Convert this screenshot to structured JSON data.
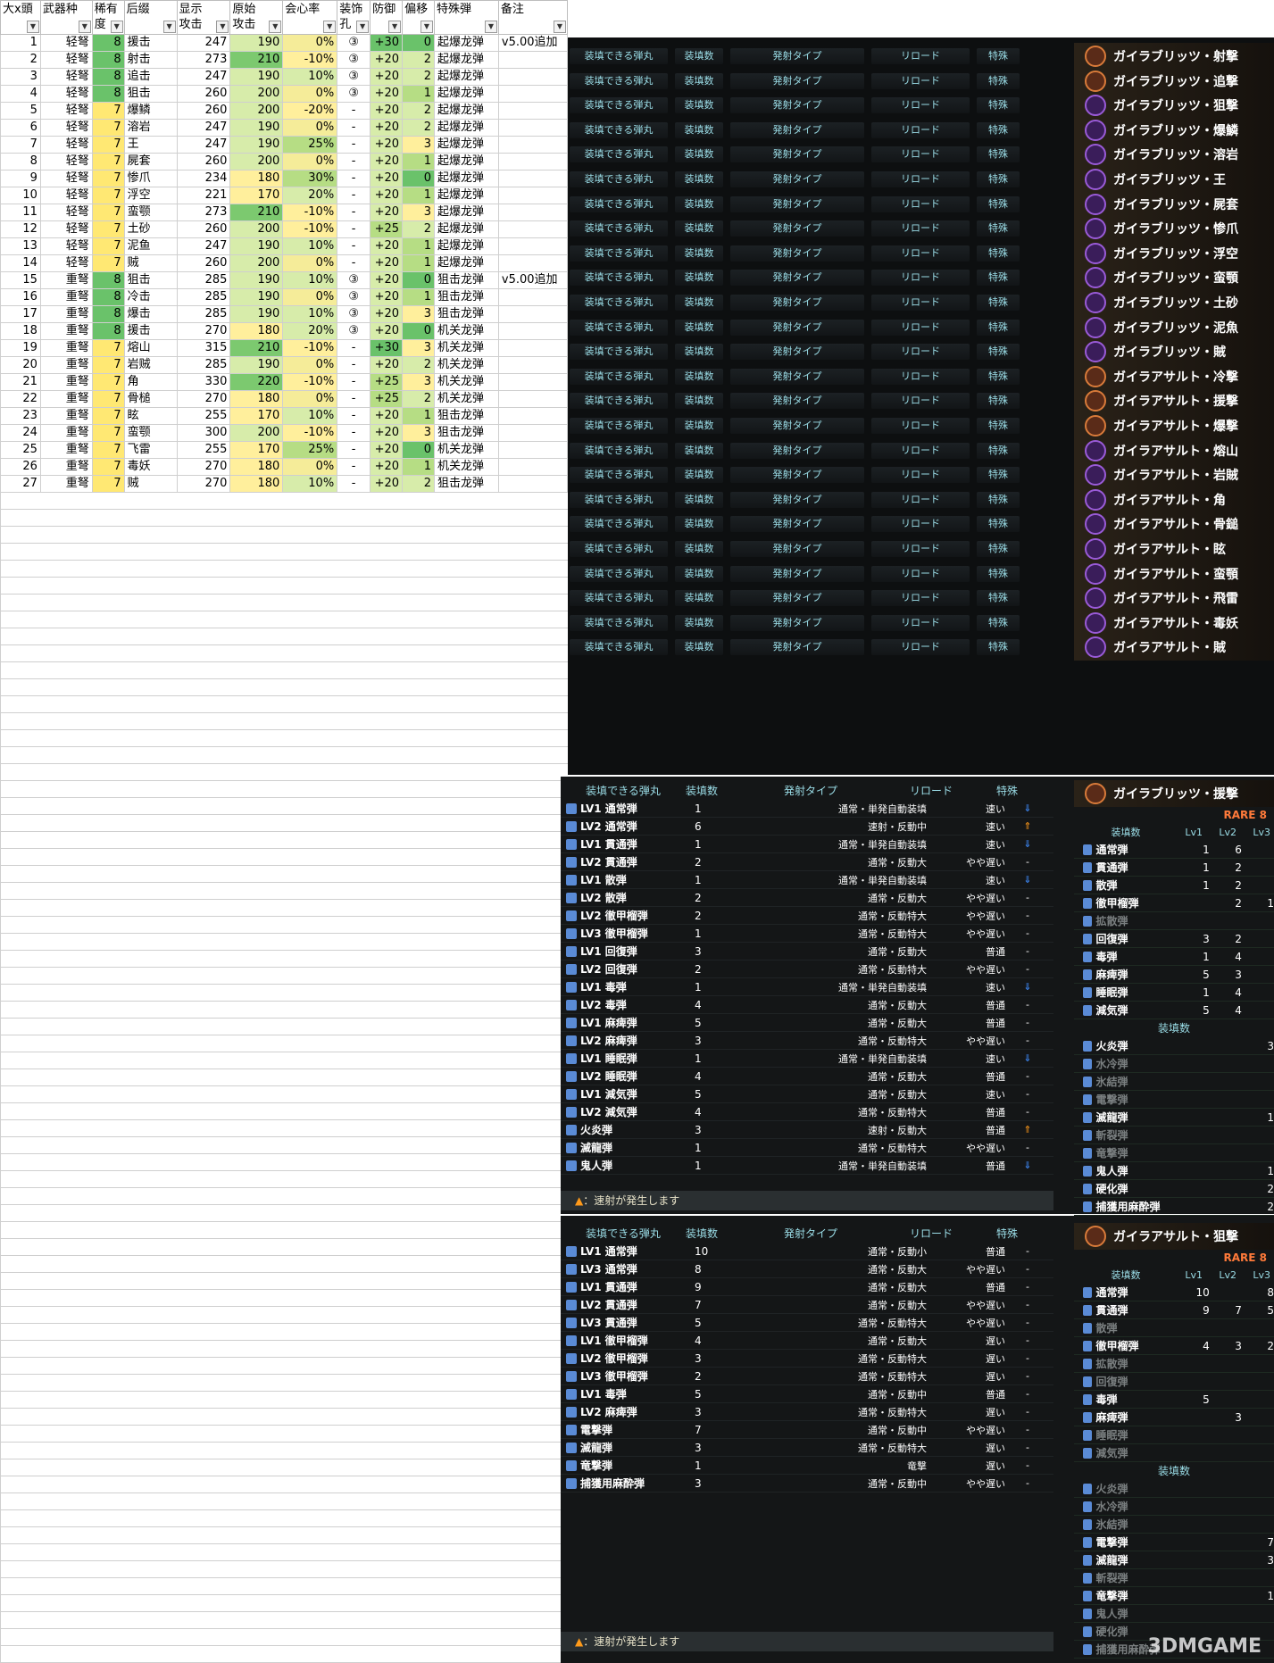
{
  "headers": [
    {
      "t1": "大x頭",
      "t2": ""
    },
    {
      "t1": "武器种",
      "t2": ""
    },
    {
      "t1": "稀有",
      "t2": "度"
    },
    {
      "t1": "后缀",
      "t2": ""
    },
    {
      "t1": "显示",
      "t2": "攻击"
    },
    {
      "t1": "原始",
      "t2": "攻击"
    },
    {
      "t1": "会心率",
      "t2": ""
    },
    {
      "t1": "装饰",
      "t2": "孔"
    },
    {
      "t1": "防御",
      "t2": ""
    },
    {
      "t1": "偏移",
      "t2": ""
    },
    {
      "t1": "特殊弾",
      "t2": ""
    },
    {
      "t1": "备注",
      "t2": ""
    }
  ],
  "rows": [
    [
      "1",
      "轻弩",
      "8",
      "援击",
      "247",
      "190",
      "0%",
      "③",
      "+30",
      "0",
      "起爆龙弹",
      "v5.00追加"
    ],
    [
      "2",
      "轻弩",
      "8",
      "射击",
      "273",
      "210",
      "-10%",
      "③",
      "+20",
      "2",
      "起爆龙弹",
      ""
    ],
    [
      "3",
      "轻弩",
      "8",
      "追击",
      "247",
      "190",
      "10%",
      "③",
      "+20",
      "2",
      "起爆龙弹",
      ""
    ],
    [
      "4",
      "轻弩",
      "8",
      "狙击",
      "260",
      "200",
      "0%",
      "③",
      "+20",
      "1",
      "起爆龙弹",
      ""
    ],
    [
      "5",
      "轻弩",
      "7",
      "爆鳞",
      "260",
      "200",
      "-20%",
      "-",
      "+20",
      "2",
      "起爆龙弹",
      ""
    ],
    [
      "6",
      "轻弩",
      "7",
      "溶岩",
      "247",
      "190",
      "0%",
      "-",
      "+20",
      "2",
      "起爆龙弹",
      ""
    ],
    [
      "7",
      "轻弩",
      "7",
      "王",
      "247",
      "190",
      "25%",
      "-",
      "+20",
      "3",
      "起爆龙弹",
      ""
    ],
    [
      "8",
      "轻弩",
      "7",
      "屍套",
      "260",
      "200",
      "0%",
      "-",
      "+20",
      "1",
      "起爆龙弹",
      ""
    ],
    [
      "9",
      "轻弩",
      "7",
      "惨爪",
      "234",
      "180",
      "30%",
      "-",
      "+20",
      "0",
      "起爆龙弹",
      ""
    ],
    [
      "10",
      "轻弩",
      "7",
      "浮空",
      "221",
      "170",
      "20%",
      "-",
      "+20",
      "1",
      "起爆龙弹",
      ""
    ],
    [
      "11",
      "轻弩",
      "7",
      "蛮颚",
      "273",
      "210",
      "-10%",
      "-",
      "+20",
      "3",
      "起爆龙弹",
      ""
    ],
    [
      "12",
      "轻弩",
      "7",
      "土砂",
      "260",
      "200",
      "-10%",
      "-",
      "+25",
      "2",
      "起爆龙弹",
      ""
    ],
    [
      "13",
      "轻弩",
      "7",
      "泥鱼",
      "247",
      "190",
      "10%",
      "-",
      "+20",
      "1",
      "起爆龙弹",
      ""
    ],
    [
      "14",
      "轻弩",
      "7",
      "贼",
      "260",
      "200",
      "0%",
      "-",
      "+20",
      "1",
      "起爆龙弹",
      ""
    ],
    [
      "15",
      "重弩",
      "8",
      "狙击",
      "285",
      "190",
      "10%",
      "③",
      "+20",
      "0",
      "狙击龙弹",
      "v5.00追加"
    ],
    [
      "16",
      "重弩",
      "8",
      "冷击",
      "285",
      "190",
      "0%",
      "③",
      "+20",
      "1",
      "狙击龙弹",
      ""
    ],
    [
      "17",
      "重弩",
      "8",
      "爆击",
      "285",
      "190",
      "10%",
      "③",
      "+20",
      "3",
      "狙击龙弹",
      ""
    ],
    [
      "18",
      "重弩",
      "8",
      "援击",
      "270",
      "180",
      "20%",
      "③",
      "+20",
      "0",
      "机关龙弹",
      ""
    ],
    [
      "19",
      "重弩",
      "7",
      "熔山",
      "315",
      "210",
      "-10%",
      "-",
      "+30",
      "3",
      "机关龙弹",
      ""
    ],
    [
      "20",
      "重弩",
      "7",
      "岩贼",
      "285",
      "190",
      "0%",
      "-",
      "+20",
      "2",
      "机关龙弹",
      ""
    ],
    [
      "21",
      "重弩",
      "7",
      "角",
      "330",
      "220",
      "-10%",
      "-",
      "+25",
      "3",
      "机关龙弹",
      ""
    ],
    [
      "22",
      "重弩",
      "7",
      "骨槌",
      "270",
      "180",
      "0%",
      "-",
      "+25",
      "2",
      "机关龙弹",
      ""
    ],
    [
      "23",
      "重弩",
      "7",
      "眩",
      "255",
      "170",
      "10%",
      "-",
      "+20",
      "1",
      "狙击龙弹",
      ""
    ],
    [
      "24",
      "重弩",
      "7",
      "蛮颚",
      "300",
      "200",
      "-10%",
      "-",
      "+20",
      "3",
      "狙击龙弹",
      ""
    ],
    [
      "25",
      "重弩",
      "7",
      "飞雷",
      "255",
      "170",
      "25%",
      "-",
      "+20",
      "0",
      "机关龙弹",
      ""
    ],
    [
      "26",
      "重弩",
      "7",
      "毒妖",
      "270",
      "180",
      "0%",
      "-",
      "+20",
      "1",
      "机关龙弹",
      ""
    ],
    [
      "27",
      "重弩",
      "7",
      "贼",
      "270",
      "180",
      "10%",
      "-",
      "+20",
      "2",
      "狙击龙弹",
      ""
    ]
  ],
  "list_labels": {
    "a": "装填できる弾丸",
    "b": "装填数",
    "c": "発射タイプ",
    "d": "リロード",
    "e": "特殊"
  },
  "weapons": [
    "ガイラブリッツ・射撃",
    "ガイラブリッツ・追撃",
    "ガイラブリッツ・狙撃",
    "ガイラブリッツ・爆鱗",
    "ガイラブリッツ・溶岩",
    "ガイラブリッツ・王",
    "ガイラブリッツ・屍套",
    "ガイラブリッツ・惨爪",
    "ガイラブリッツ・浮空",
    "ガイラブリッツ・蛮顎",
    "ガイラブリッツ・土砂",
    "ガイラブリッツ・泥魚",
    "ガイラブリッツ・賊",
    "ガイラアサルト・冷撃",
    "ガイラアサルト・援撃",
    "ガイラアサルト・爆撃",
    "ガイラアサルト・熔山",
    "ガイラアサルト・岩賊",
    "ガイラアサルト・角",
    "ガイラアサルト・骨鎚",
    "ガイラアサルト・眩",
    "ガイラアサルト・蛮顎",
    "ガイラアサルト・飛雷",
    "ガイラアサルト・毒妖",
    "ガイラアサルト・賊"
  ],
  "panel1": {
    "title": "ガイラブリッツ・援撃",
    "rare": "RARE 8",
    "ammo": [
      [
        "LV1 通常弾",
        "1",
        "通常・単発自動装填",
        "速い",
        "dn"
      ],
      [
        "LV2 通常弾",
        "6",
        "速射・反動中",
        "速い",
        "up"
      ],
      [
        "LV1 貫通弾",
        "1",
        "通常・単発自動装填",
        "速い",
        "dn"
      ],
      [
        "LV2 貫通弾",
        "2",
        "通常・反動大",
        "やや遅い",
        "-"
      ],
      [
        "LV1 散弾",
        "1",
        "通常・単発自動装填",
        "速い",
        "dn"
      ],
      [
        "LV2 散弾",
        "2",
        "通常・反動大",
        "やや遅い",
        "-"
      ],
      [
        "LV2 徹甲榴弾",
        "2",
        "通常・反動特大",
        "やや遅い",
        "-"
      ],
      [
        "LV3 徹甲榴弾",
        "1",
        "通常・反動特大",
        "やや遅い",
        "-"
      ],
      [
        "LV1 回復弾",
        "3",
        "通常・反動大",
        "普通",
        "-"
      ],
      [
        "LV2 回復弾",
        "2",
        "通常・反動特大",
        "やや遅い",
        "-"
      ],
      [
        "LV1 毒弾",
        "1",
        "通常・単発自動装填",
        "速い",
        "dn"
      ],
      [
        "LV2 毒弾",
        "4",
        "通常・反動大",
        "普通",
        "-"
      ],
      [
        "LV1 麻痺弾",
        "5",
        "通常・反動大",
        "普通",
        "-"
      ],
      [
        "LV2 麻痺弾",
        "3",
        "通常・反動特大",
        "やや遅い",
        "-"
      ],
      [
        "LV1 睡眠弾",
        "1",
        "通常・単発自動装填",
        "速い",
        "dn"
      ],
      [
        "LV2 睡眠弾",
        "4",
        "通常・反動大",
        "普通",
        "-"
      ],
      [
        "LV1 減気弾",
        "5",
        "通常・反動大",
        "速い",
        "-"
      ],
      [
        "LV2 減気弾",
        "4",
        "通常・反動特大",
        "普通",
        "-"
      ],
      [
        "火炎弾",
        "3",
        "速射・反動大",
        "普通",
        "up"
      ],
      [
        "滅龍弾",
        "1",
        "通常・反動特大",
        "やや遅い",
        "-"
      ],
      [
        "鬼人弾",
        "1",
        "通常・単発自動装填",
        "普通",
        "dn"
      ]
    ],
    "side_head": {
      "a": "装填数",
      "b": "Lv1",
      "c": "Lv2",
      "d": "Lv3"
    },
    "side": [
      [
        "通常弾",
        "1",
        "6",
        ""
      ],
      [
        "貫通弾",
        "1",
        "2",
        ""
      ],
      [
        "散弾",
        "1",
        "2",
        ""
      ],
      [
        "徹甲榴弾",
        "",
        "2",
        "1"
      ],
      [
        "拡散弾",
        "",
        "",
        ""
      ],
      [
        "回復弾",
        "3",
        "2",
        ""
      ],
      [
        "毒弾",
        "1",
        "4",
        ""
      ],
      [
        "麻痺弾",
        "5",
        "3",
        ""
      ],
      [
        "睡眠弾",
        "1",
        "4",
        ""
      ],
      [
        "減気弾",
        "5",
        "4",
        ""
      ]
    ],
    "side_title2": "装填数",
    "side2": [
      [
        "火炎弾",
        "3"
      ],
      [
        "水冷弾",
        ""
      ],
      [
        "氷結弾",
        ""
      ],
      [
        "電撃弾",
        ""
      ],
      [
        "滅龍弾",
        "1"
      ],
      [
        "斬裂弾",
        ""
      ],
      [
        "竜撃弾",
        ""
      ],
      [
        "鬼人弾",
        "1"
      ],
      [
        "硬化弾",
        "2"
      ],
      [
        "捕獲用麻酔弾",
        "2"
      ]
    ],
    "foot": "：速射が発生します"
  },
  "panel2": {
    "title": "ガイラアサルト・狙撃",
    "rare": "RARE 8",
    "ammo": [
      [
        "LV1 通常弾",
        "10",
        "通常・反動小",
        "普通",
        "-"
      ],
      [
        "LV3 通常弾",
        "8",
        "通常・反動大",
        "やや遅い",
        "-"
      ],
      [
        "LV1 貫通弾",
        "9",
        "通常・反動大",
        "普通",
        "-"
      ],
      [
        "LV2 貫通弾",
        "7",
        "通常・反動大",
        "やや遅い",
        "-"
      ],
      [
        "LV3 貫通弾",
        "5",
        "通常・反動特大",
        "やや遅い",
        "-"
      ],
      [
        "LV1 徹甲榴弾",
        "4",
        "通常・反動大",
        "遅い",
        "-"
      ],
      [
        "LV2 徹甲榴弾",
        "3",
        "通常・反動特大",
        "遅い",
        "-"
      ],
      [
        "LV3 徹甲榴弾",
        "2",
        "通常・反動特大",
        "遅い",
        "-"
      ],
      [
        "LV1 毒弾",
        "5",
        "通常・反動中",
        "普通",
        "-"
      ],
      [
        "LV2 麻痺弾",
        "3",
        "通常・反動特大",
        "遅い",
        "-"
      ],
      [
        "電撃弾",
        "7",
        "通常・反動中",
        "やや遅い",
        "-"
      ],
      [
        "滅龍弾",
        "3",
        "通常・反動特大",
        "遅い",
        "-"
      ],
      [
        "竜撃弾",
        "1",
        "竜撃",
        "遅い",
        "-"
      ],
      [
        "捕獲用麻酔弾",
        "3",
        "通常・反動中",
        "やや遅い",
        "-"
      ]
    ],
    "side": [
      [
        "通常弾",
        "10",
        "",
        "8"
      ],
      [
        "貫通弾",
        "9",
        "7",
        "5"
      ],
      [
        "散弾",
        "",
        "",
        ""
      ],
      [
        "徹甲榴弾",
        "4",
        "3",
        "2"
      ],
      [
        "拡散弾",
        "",
        "",
        ""
      ],
      [
        "回復弾",
        "",
        "",
        ""
      ],
      [
        "毒弾",
        "5",
        "",
        ""
      ],
      [
        "麻痺弾",
        "",
        "3",
        ""
      ],
      [
        "睡眠弾",
        "",
        "",
        ""
      ],
      [
        "減気弾",
        "",
        "",
        ""
      ]
    ],
    "side2": [
      [
        "火炎弾",
        ""
      ],
      [
        "水冷弾",
        ""
      ],
      [
        "氷結弾",
        ""
      ],
      [
        "電撃弾",
        "7"
      ],
      [
        "滅龍弾",
        "3"
      ],
      [
        "斬裂弾",
        ""
      ],
      [
        "竜撃弾",
        "1"
      ],
      [
        "鬼人弾",
        ""
      ],
      [
        "硬化弾",
        ""
      ],
      [
        "捕獲用麻酔弾",
        ""
      ]
    ],
    "foot": "：速射が発生します"
  },
  "watermark": "3DMGAME"
}
